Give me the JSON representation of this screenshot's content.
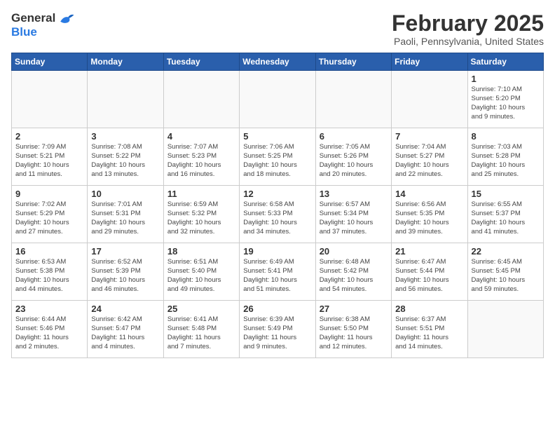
{
  "header": {
    "logo_general": "General",
    "logo_blue": "Blue",
    "month": "February 2025",
    "location": "Paoli, Pennsylvania, United States"
  },
  "weekdays": [
    "Sunday",
    "Monday",
    "Tuesday",
    "Wednesday",
    "Thursday",
    "Friday",
    "Saturday"
  ],
  "weeks": [
    [
      {
        "day": "",
        "info": ""
      },
      {
        "day": "",
        "info": ""
      },
      {
        "day": "",
        "info": ""
      },
      {
        "day": "",
        "info": ""
      },
      {
        "day": "",
        "info": ""
      },
      {
        "day": "",
        "info": ""
      },
      {
        "day": "1",
        "info": "Sunrise: 7:10 AM\nSunset: 5:20 PM\nDaylight: 10 hours\nand 9 minutes."
      }
    ],
    [
      {
        "day": "2",
        "info": "Sunrise: 7:09 AM\nSunset: 5:21 PM\nDaylight: 10 hours\nand 11 minutes."
      },
      {
        "day": "3",
        "info": "Sunrise: 7:08 AM\nSunset: 5:22 PM\nDaylight: 10 hours\nand 13 minutes."
      },
      {
        "day": "4",
        "info": "Sunrise: 7:07 AM\nSunset: 5:23 PM\nDaylight: 10 hours\nand 16 minutes."
      },
      {
        "day": "5",
        "info": "Sunrise: 7:06 AM\nSunset: 5:25 PM\nDaylight: 10 hours\nand 18 minutes."
      },
      {
        "day": "6",
        "info": "Sunrise: 7:05 AM\nSunset: 5:26 PM\nDaylight: 10 hours\nand 20 minutes."
      },
      {
        "day": "7",
        "info": "Sunrise: 7:04 AM\nSunset: 5:27 PM\nDaylight: 10 hours\nand 22 minutes."
      },
      {
        "day": "8",
        "info": "Sunrise: 7:03 AM\nSunset: 5:28 PM\nDaylight: 10 hours\nand 25 minutes."
      }
    ],
    [
      {
        "day": "9",
        "info": "Sunrise: 7:02 AM\nSunset: 5:29 PM\nDaylight: 10 hours\nand 27 minutes."
      },
      {
        "day": "10",
        "info": "Sunrise: 7:01 AM\nSunset: 5:31 PM\nDaylight: 10 hours\nand 29 minutes."
      },
      {
        "day": "11",
        "info": "Sunrise: 6:59 AM\nSunset: 5:32 PM\nDaylight: 10 hours\nand 32 minutes."
      },
      {
        "day": "12",
        "info": "Sunrise: 6:58 AM\nSunset: 5:33 PM\nDaylight: 10 hours\nand 34 minutes."
      },
      {
        "day": "13",
        "info": "Sunrise: 6:57 AM\nSunset: 5:34 PM\nDaylight: 10 hours\nand 37 minutes."
      },
      {
        "day": "14",
        "info": "Sunrise: 6:56 AM\nSunset: 5:35 PM\nDaylight: 10 hours\nand 39 minutes."
      },
      {
        "day": "15",
        "info": "Sunrise: 6:55 AM\nSunset: 5:37 PM\nDaylight: 10 hours\nand 41 minutes."
      }
    ],
    [
      {
        "day": "16",
        "info": "Sunrise: 6:53 AM\nSunset: 5:38 PM\nDaylight: 10 hours\nand 44 minutes."
      },
      {
        "day": "17",
        "info": "Sunrise: 6:52 AM\nSunset: 5:39 PM\nDaylight: 10 hours\nand 46 minutes."
      },
      {
        "day": "18",
        "info": "Sunrise: 6:51 AM\nSunset: 5:40 PM\nDaylight: 10 hours\nand 49 minutes."
      },
      {
        "day": "19",
        "info": "Sunrise: 6:49 AM\nSunset: 5:41 PM\nDaylight: 10 hours\nand 51 minutes."
      },
      {
        "day": "20",
        "info": "Sunrise: 6:48 AM\nSunset: 5:42 PM\nDaylight: 10 hours\nand 54 minutes."
      },
      {
        "day": "21",
        "info": "Sunrise: 6:47 AM\nSunset: 5:44 PM\nDaylight: 10 hours\nand 56 minutes."
      },
      {
        "day": "22",
        "info": "Sunrise: 6:45 AM\nSunset: 5:45 PM\nDaylight: 10 hours\nand 59 minutes."
      }
    ],
    [
      {
        "day": "23",
        "info": "Sunrise: 6:44 AM\nSunset: 5:46 PM\nDaylight: 11 hours\nand 2 minutes."
      },
      {
        "day": "24",
        "info": "Sunrise: 6:42 AM\nSunset: 5:47 PM\nDaylight: 11 hours\nand 4 minutes."
      },
      {
        "day": "25",
        "info": "Sunrise: 6:41 AM\nSunset: 5:48 PM\nDaylight: 11 hours\nand 7 minutes."
      },
      {
        "day": "26",
        "info": "Sunrise: 6:39 AM\nSunset: 5:49 PM\nDaylight: 11 hours\nand 9 minutes."
      },
      {
        "day": "27",
        "info": "Sunrise: 6:38 AM\nSunset: 5:50 PM\nDaylight: 11 hours\nand 12 minutes."
      },
      {
        "day": "28",
        "info": "Sunrise: 6:37 AM\nSunset: 5:51 PM\nDaylight: 11 hours\nand 14 minutes."
      },
      {
        "day": "",
        "info": ""
      }
    ]
  ]
}
